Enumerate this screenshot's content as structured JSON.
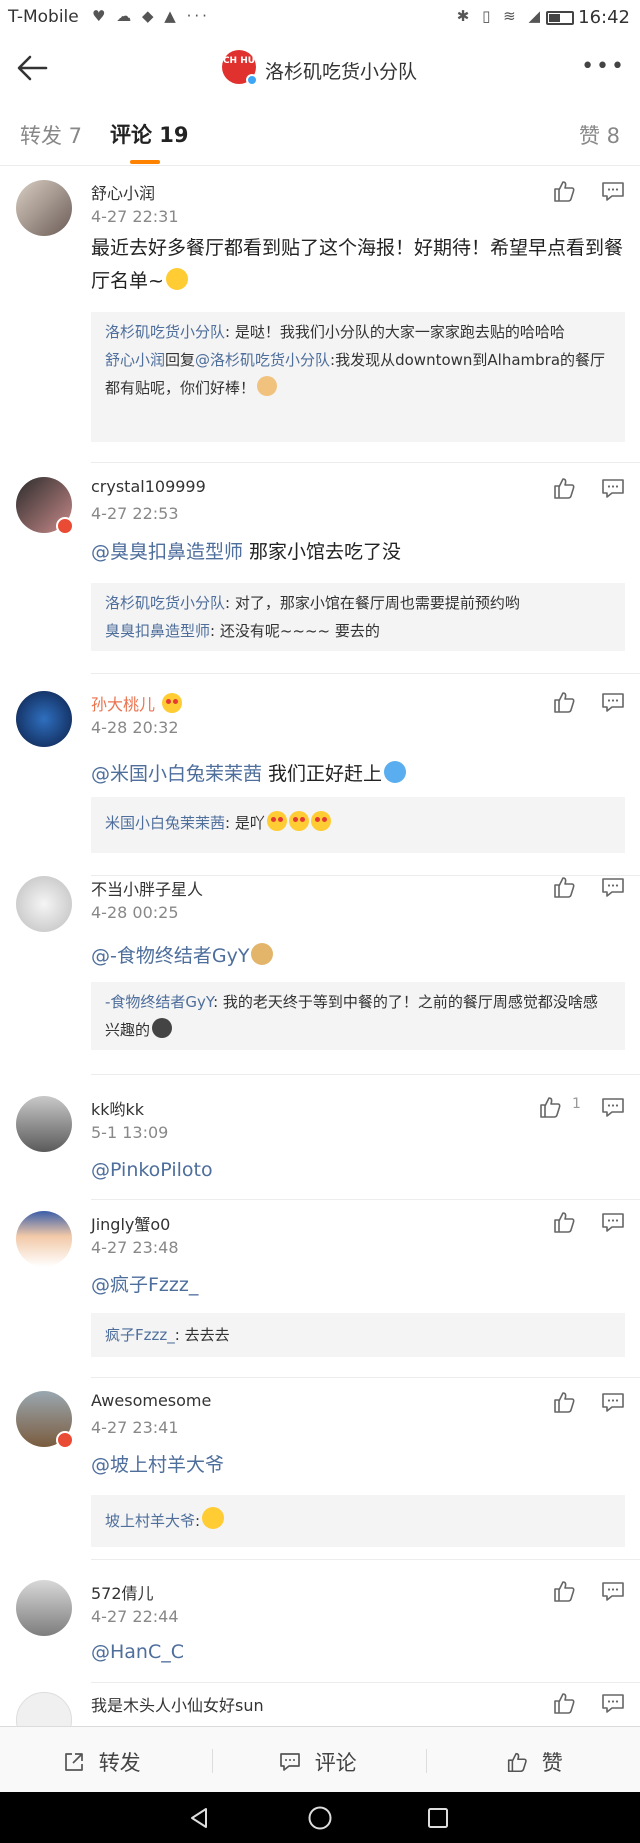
{
  "status_bar": {
    "carrier": "T-Mobile",
    "time": "16:42"
  },
  "nav": {
    "title": "洛杉矶吃货小分队",
    "logo_text": "CH HU",
    "more": "•••"
  },
  "tabs": {
    "repost": "转发 7",
    "comment": "评论 19",
    "like": "赞 8"
  },
  "comments": [
    {
      "user": "舒心小润",
      "date": "4-27 22:31",
      "text": "最近去好多餐厅都看到贴了这个海报！好期待！希望早点看到餐厅名单~",
      "replies": [
        {
          "name": "洛杉矶吃货小分队",
          "text": ": 是哒！我我们小分队的大家一家家跑去贴的哈哈哈"
        },
        {
          "name": "舒心小润",
          "mid": "回复",
          "at": "@洛杉矶吃货小分队",
          "text": ":我发现从downtown到Alhambra的餐厅都有贴呢，你们好棒！"
        }
      ]
    },
    {
      "user": "crystal109999",
      "date": "4-27 22:53",
      "at": "@臭臭扣鼻造型师",
      "text": " 那家小馆去吃了没",
      "replies": [
        {
          "name": "洛杉矶吃货小分队",
          "text": ": 对了，那家小馆在餐厅周也需要提前预约哟"
        },
        {
          "name": "臭臭扣鼻造型师",
          "text": ": 还没有呢~~~~ 要去的"
        }
      ]
    },
    {
      "user": "孙大桃儿",
      "date": "4-28 20:32",
      "at": "@米国小白兔茉茉茜",
      "text": " 我们正好赶上",
      "replies": [
        {
          "name": "米国小白兔茉茉茜",
          "text": ": 是吖"
        }
      ]
    },
    {
      "user": "不当小胖子星人",
      "date": "4-28 00:25",
      "at": "@-食物终结者GyY",
      "replies": [
        {
          "name": "-食物终结者GyY",
          "text": ": 我的老天终于等到中餐的了！之前的餐厅周感觉都没啥感兴趣的"
        }
      ]
    },
    {
      "user": "kk哟kk",
      "date": "5-1 13:09",
      "at": "@PinkoPiloto",
      "like_count": "1"
    },
    {
      "user": "Jingly蟹o0",
      "date": "4-27 23:48",
      "at": "@疯子Fzzz_",
      "replies": [
        {
          "name": "疯子Fzzz_",
          "text": ": 去去去"
        }
      ]
    },
    {
      "user": "Awesomesome",
      "date": "4-27 23:41",
      "at": "@坡上村羊大爷",
      "replies": [
        {
          "name": "坡上村羊大爷",
          "text": ":"
        }
      ]
    },
    {
      "user": "572倩儿",
      "date": "4-27 22:44",
      "at": "@HanC_C"
    },
    {
      "user": "我是木头人小仙女好sun"
    }
  ],
  "bottom": {
    "repost": "转发",
    "comment": "评论",
    "like": "赞"
  },
  "colors": {
    "link": "#4e6e9c",
    "accent": "#ff8200",
    "vip_name": "#eb7350"
  },
  "icons": [
    "back-arrow-icon",
    "more-icon",
    "thumb-up-icon",
    "reply-icon",
    "share-icon",
    "comment-icon"
  ]
}
